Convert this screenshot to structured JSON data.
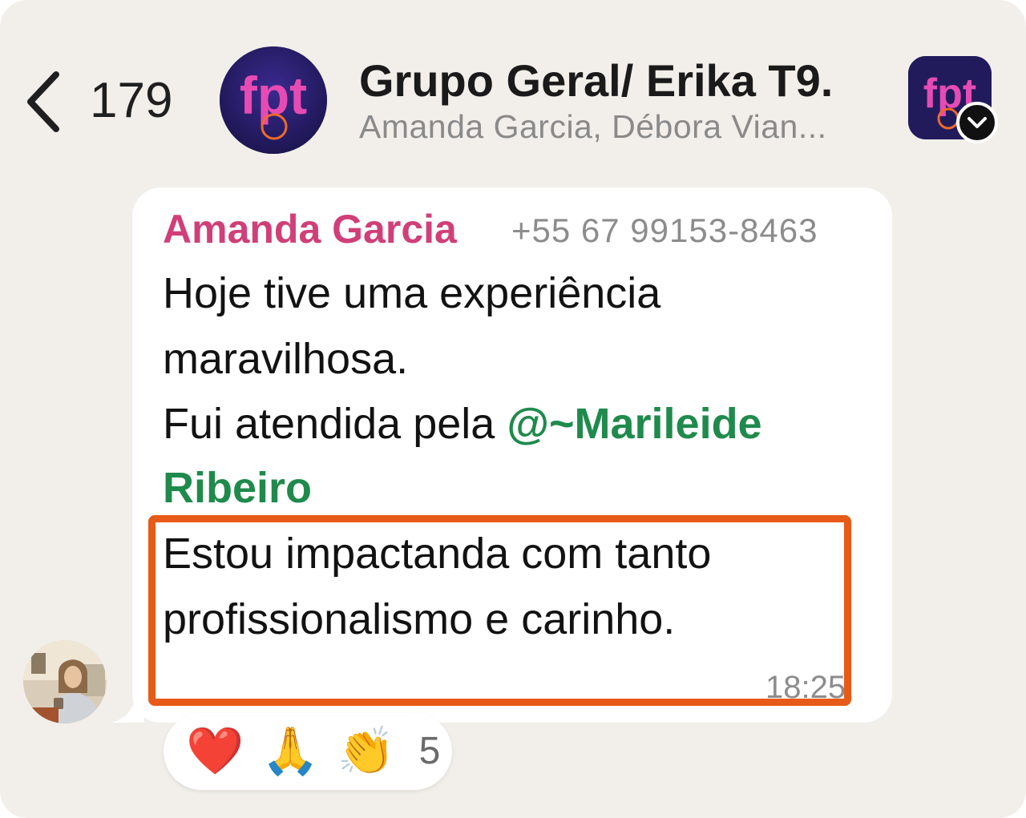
{
  "header": {
    "unread_count": "179",
    "group_avatar_logo": "fpt",
    "title": "Grupo Geral/ Erika T9.",
    "members": "Amanda Garcia, Débora Vian...",
    "app_icon_logo": "fpt"
  },
  "message": {
    "sender_name": "Amanda Garcia",
    "sender_phone": "+55 67 99153-8463",
    "line1": "Hoje tive uma experiência",
    "line2": "maravilhosa.",
    "line3_prefix": "Fui atendida pela ",
    "mention_part1": "@~Marileide",
    "mention_part2": "Ribeiro",
    "line5": "Estou impactanda com tanto",
    "line6": "profissionalismo e carinho.",
    "time": "18:25"
  },
  "reactions": {
    "emojis": [
      "❤️",
      "🙏",
      "👏"
    ],
    "count": "5"
  },
  "colors": {
    "background": "#f2efea",
    "sender_name": "#d03f78",
    "mention": "#1f8a4c",
    "highlight": "#e85a17",
    "logo_bg": "#211b5c",
    "logo_text": "#e64bb4"
  },
  "icons": {
    "back": "chevron-left-icon",
    "badge": "chevron-down-icon"
  }
}
